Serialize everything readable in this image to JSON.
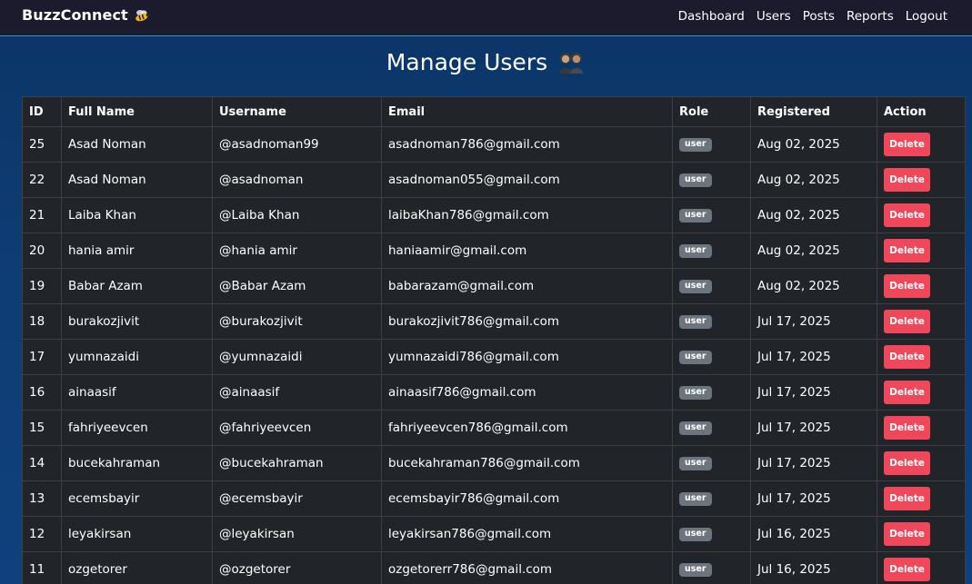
{
  "nav": {
    "brand": "BuzzConnect",
    "brand_icon": "bee-icon",
    "links": [
      "Dashboard",
      "Users",
      "Posts",
      "Reports",
      "Logout"
    ]
  },
  "page": {
    "title": "Manage Users",
    "title_icon": "users-icon"
  },
  "table": {
    "headers": [
      "ID",
      "Full Name",
      "Username",
      "Email",
      "Role",
      "Registered",
      "Action"
    ],
    "rows": [
      [
        "25",
        "Asad Noman",
        "@asadnoman99",
        "asadnoman786@gmail.com",
        "user",
        "Aug 02, 2025",
        "Delete"
      ],
      [
        "22",
        "Asad Noman",
        "@asadnoman",
        "asadnoman055@gmail.com",
        "user",
        "Aug 02, 2025",
        "Delete"
      ],
      [
        "21",
        "Laiba Khan",
        "@Laiba Khan",
        "laibaKhan786@gmail.com",
        "user",
        "Aug 02, 2025",
        "Delete"
      ],
      [
        "20",
        "hania amir",
        "@hania amir",
        "haniaamir@gmail.com",
        "user",
        "Aug 02, 2025",
        "Delete"
      ],
      [
        "19",
        "Babar Azam",
        "@Babar Azam",
        "babarazam@gmail.com",
        "user",
        "Aug 02, 2025",
        "Delete"
      ],
      [
        "18",
        "burakozjivit",
        "@burakozjivit",
        "burakozjivit786@gmail.com",
        "user",
        "Jul 17, 2025",
        "Delete"
      ],
      [
        "17",
        "yumnazaidi",
        "@yumnazaidi",
        "yumnazaidi786@gmail.com",
        "user",
        "Jul 17, 2025",
        "Delete"
      ],
      [
        "16",
        "ainaasif",
        "@ainaasif",
        "ainaasif786@gmail.com",
        "user",
        "Jul 17, 2025",
        "Delete"
      ],
      [
        "15",
        "fahriyeevcen",
        "@fahriyeevcen",
        "fahriyeevcen786@gmail.com",
        "user",
        "Jul 17, 2025",
        "Delete"
      ],
      [
        "14",
        "bucekahraman",
        "@bucekahraman",
        "bucekahraman786@gmail.com",
        "user",
        "Jul 17, 2025",
        "Delete"
      ],
      [
        "13",
        "ecemsbayir",
        "@ecemsbayir",
        "ecemsbayir786@gmail.com",
        "user",
        "Jul 17, 2025",
        "Delete"
      ],
      [
        "12",
        "leyakirsan",
        "@leyakirsan",
        "leyakirsan786@gmail.com",
        "user",
        "Jul 16, 2025",
        "Delete"
      ],
      [
        "11",
        "ozgetorer",
        "@ozgetorer",
        "ozgetorerr786@gmail.com",
        "user",
        "Jul 16, 2025",
        "Delete"
      ]
    ]
  },
  "colors": {
    "navbar_bg": "#1c1b2e",
    "page_bg": "#0e3b73",
    "table_bg": "#212529",
    "delete_btn": "#f0475a",
    "role_badge": "#6c757d"
  }
}
